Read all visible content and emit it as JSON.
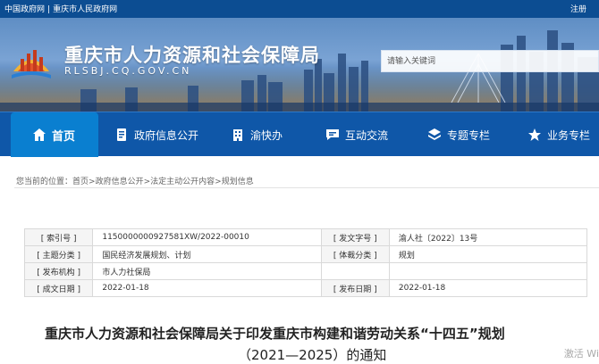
{
  "topbar": {
    "link1": "中国政府网",
    "link2": "重庆市人民政府网",
    "login": "注册"
  },
  "header": {
    "title": "重庆市人力资源和社会保障局",
    "domain": "RLSBJ.CQ.GOV.CN",
    "search_placeholder": "请输入关键词"
  },
  "nav": {
    "items": [
      {
        "label": "首页",
        "icon": "home-icon",
        "active": true
      },
      {
        "label": "政府信息公开",
        "icon": "document-icon"
      },
      {
        "label": "渝快办",
        "icon": "building-icon"
      },
      {
        "label": "互动交流",
        "icon": "chat-icon"
      },
      {
        "label": "专题专栏",
        "icon": "layers-icon"
      },
      {
        "label": "业务专栏",
        "icon": "star-icon"
      }
    ]
  },
  "breadcrumb": {
    "prefix": "您当前的位置：",
    "items": [
      "首页",
      "政府信息公开",
      "法定主动公开内容",
      "规划信息"
    ],
    "separator": ">"
  },
  "meta": {
    "rows": [
      {
        "k1": "[ 索引号 ]",
        "v1": "11500000009275 81XW/2022-00010",
        "k2": "[ 发文字号 ]",
        "v2": "渝人社〔2022〕13号"
      },
      {
        "k1": "[ 主题分类 ]",
        "v1": "国民经济发展规划、计划",
        "k2": "[ 体裁分类 ]",
        "v2": "规划"
      },
      {
        "k1": "[ 发布机构 ]",
        "v1": "市人力社保局",
        "k2": "",
        "v2": ""
      },
      {
        "k1": "[ 成文日期 ]",
        "v1": "2022-01-18",
        "k2": "[ 发布日期 ]",
        "v2": "2022-01-18"
      }
    ]
  },
  "document": {
    "title_line1": "重庆市人力资源和社会保障局关于印发重庆市构建和谐劳动关系“十四五”规划",
    "title_line2": "（2021—2025）的通知"
  },
  "watermark": "激活 Wi"
}
